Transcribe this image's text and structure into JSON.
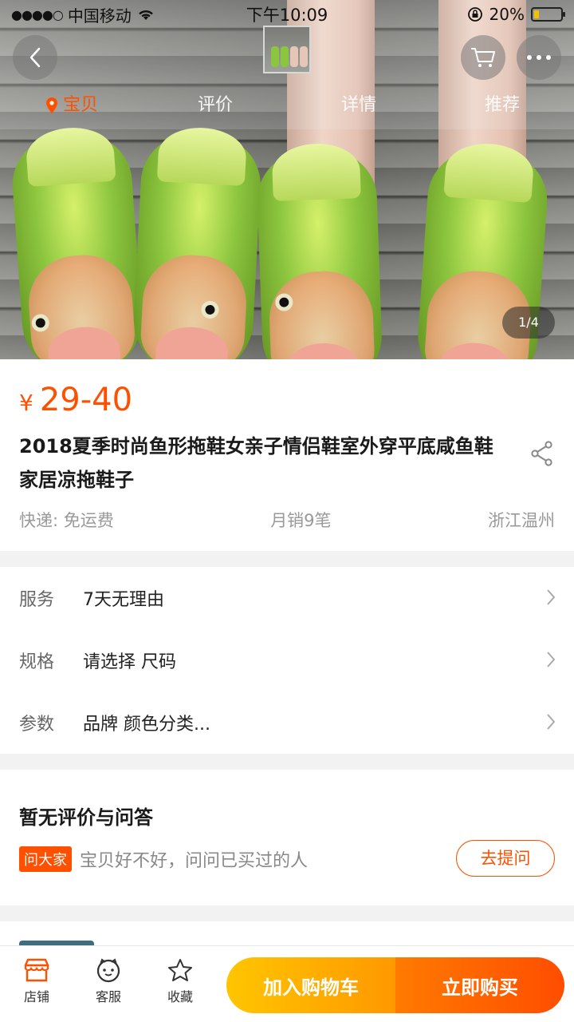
{
  "status_bar": {
    "signal": "●●●●○",
    "carrier": "中国移动",
    "time": "下午10:09",
    "battery": "20%",
    "battery_level": 0.2
  },
  "header": {
    "tabs": [
      {
        "label": "宝贝",
        "active": true
      },
      {
        "label": "评价",
        "active": false
      },
      {
        "label": "详情",
        "active": false
      },
      {
        "label": "推荐",
        "active": false
      }
    ],
    "image_counter": "1/4"
  },
  "product": {
    "currency": "¥",
    "price": "29-40",
    "title": "2018夏季时尚鱼形拖鞋女亲子情侣鞋室外穿平底咸鱼鞋家居凉拖鞋子",
    "shipping": "快递: 免运费",
    "monthly_sales": "月销9笔",
    "location": "浙江温州"
  },
  "options": [
    {
      "key": "服务",
      "value": "7天无理由"
    },
    {
      "key": "规格",
      "value": "请选择 尺码"
    },
    {
      "key": "参数",
      "value": "品牌 颜色分类..."
    }
  ],
  "qa": {
    "title": "暂无评价与问答",
    "tag": "问大家",
    "prompt": "宝贝好不好，问问已买过的人",
    "ask_button": "去提问"
  },
  "bottom_bar": {
    "shop": "店铺",
    "service": "客服",
    "favorite": "收藏",
    "add_to_cart": "加入购物车",
    "buy_now": "立即购买"
  },
  "colors": {
    "accent": "#ff5000",
    "cart_gradient": [
      "#ffc500",
      "#ff9800"
    ],
    "buy_gradient": [
      "#ff7a00",
      "#ff4d00"
    ]
  }
}
